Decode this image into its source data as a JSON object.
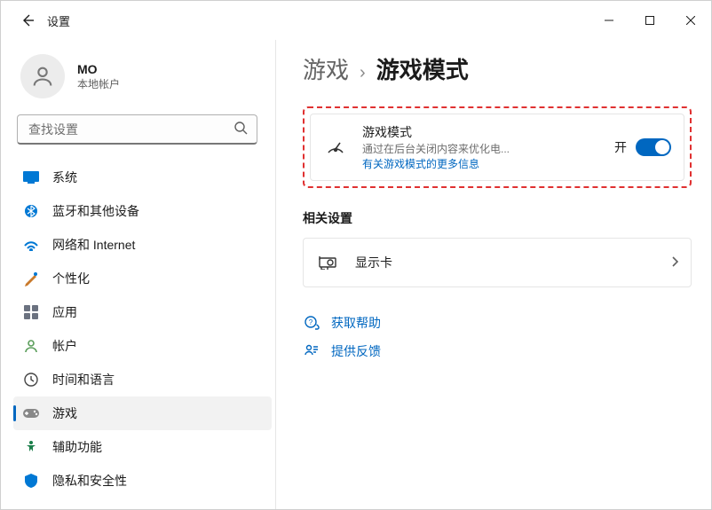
{
  "app_title": "设置",
  "user": {
    "name": "MO",
    "type": "本地帐户"
  },
  "search": {
    "placeholder": "查找设置"
  },
  "sidebar": {
    "items": [
      {
        "label": "系统",
        "icon": "system"
      },
      {
        "label": "蓝牙和其他设备",
        "icon": "bluetooth"
      },
      {
        "label": "网络和 Internet",
        "icon": "network"
      },
      {
        "label": "个性化",
        "icon": "personalize"
      },
      {
        "label": "应用",
        "icon": "apps"
      },
      {
        "label": "帐户",
        "icon": "accounts"
      },
      {
        "label": "时间和语言",
        "icon": "time"
      },
      {
        "label": "游戏",
        "icon": "gaming"
      },
      {
        "label": "辅助功能",
        "icon": "accessibility"
      },
      {
        "label": "隐私和安全性",
        "icon": "privacy"
      }
    ],
    "active_index": 7
  },
  "breadcrumb": {
    "root": "游戏",
    "leaf": "游戏模式"
  },
  "game_mode_card": {
    "title": "游戏模式",
    "desc": "通过在后台关闭内容来优化电...",
    "link": "有关游戏模式的更多信息",
    "toggle_label": "开"
  },
  "related": {
    "heading": "相关设置",
    "items": [
      {
        "label": "显示卡"
      }
    ]
  },
  "help": {
    "get_help": "获取帮助",
    "feedback": "提供反馈"
  }
}
